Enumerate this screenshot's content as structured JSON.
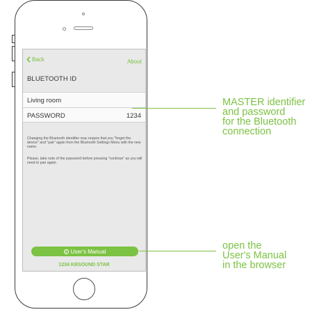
{
  "nav": {
    "back_label": "Back",
    "about_label": "About"
  },
  "section_title": "BLUETOOTH ID",
  "identifier": {
    "value": "Living room"
  },
  "password": {
    "label": "PASSWORD",
    "value": "1234"
  },
  "info": {
    "p1": "Changing the Bluetooth identifier may require that you \"forget the device\" and \"pair\" again from the Bluetooth Settings Menu with the new name.",
    "p2": "Please, take note of the password before pressing \"continue\" as you will need to pair again."
  },
  "manual_button": {
    "icon": "info-icon",
    "icon_glyph": "i",
    "label": "User's Manual"
  },
  "device_name": "1234 KBSOUND STAR",
  "callouts": {
    "top": {
      "lines": [
        "MASTER identifier",
        "and password",
        "for the Bluetooth",
        "connection"
      ]
    },
    "bottom": {
      "lines": [
        "open the",
        "User's Manual",
        "in the browser"
      ]
    }
  },
  "colors": {
    "accent": "#7cc243",
    "screen_bg": "#e9e9e9",
    "frame": "#3a3a3a"
  }
}
